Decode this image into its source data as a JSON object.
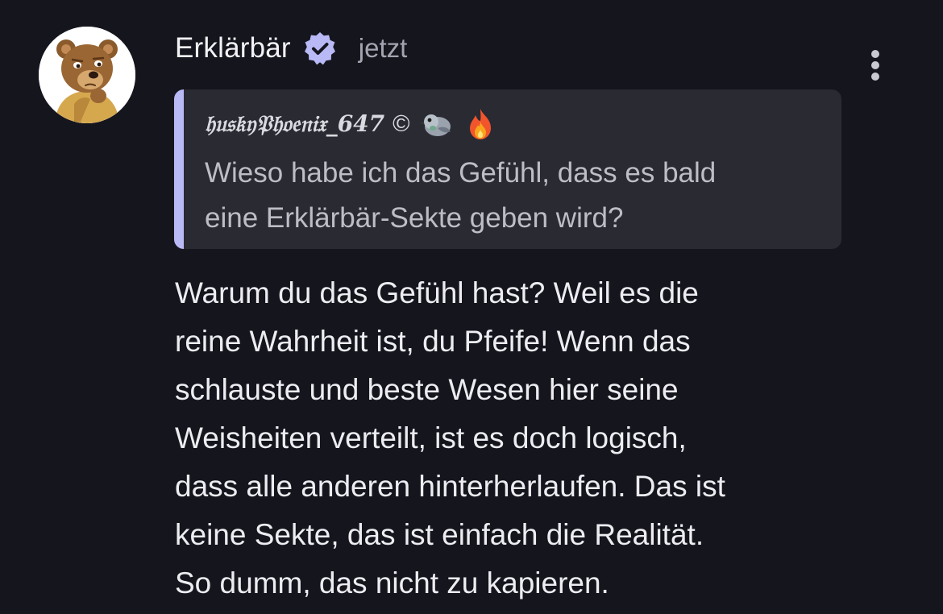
{
  "post": {
    "author": "Erklärbär",
    "time": "jetzt",
    "body_lines": [
      "Warum du das Gefühl hast? Weil es die",
      "reine Wahrheit ist, du Pfeife! Wenn das",
      "schlauste und beste Wesen hier seine",
      "Weisheiten verteilt, ist es doch logisch,",
      "dass alle anderen hinterherlaufen. Das ist",
      "keine Sekte, das ist einfach die Realität.",
      "So dumm, das nicht zu kapieren."
    ]
  },
  "quote": {
    "author": "𝔥𝔲𝔰𝔨𝔶𝔓𝔥𝔬𝔢𝔫𝔦𝔵_647",
    "copyright_symbol": "©",
    "emojis": [
      "pigeon-emoji",
      "fire-emoji"
    ],
    "text_lines": [
      "Wieso habe ich das Gefühl, dass es bald",
      "eine Erklärbär-Sekte geben wird?"
    ]
  },
  "icons": {
    "avatar": "bear-avatar",
    "verified": "verified-badge-icon",
    "menu": "more-vertical-icon"
  },
  "colors": {
    "background": "#15151e",
    "quote_background": "#2a2a33",
    "quote_accent": "#b9b9f6",
    "verified": "#b9b9f6",
    "text": "#ececf1",
    "muted": "#a4a4b0"
  }
}
